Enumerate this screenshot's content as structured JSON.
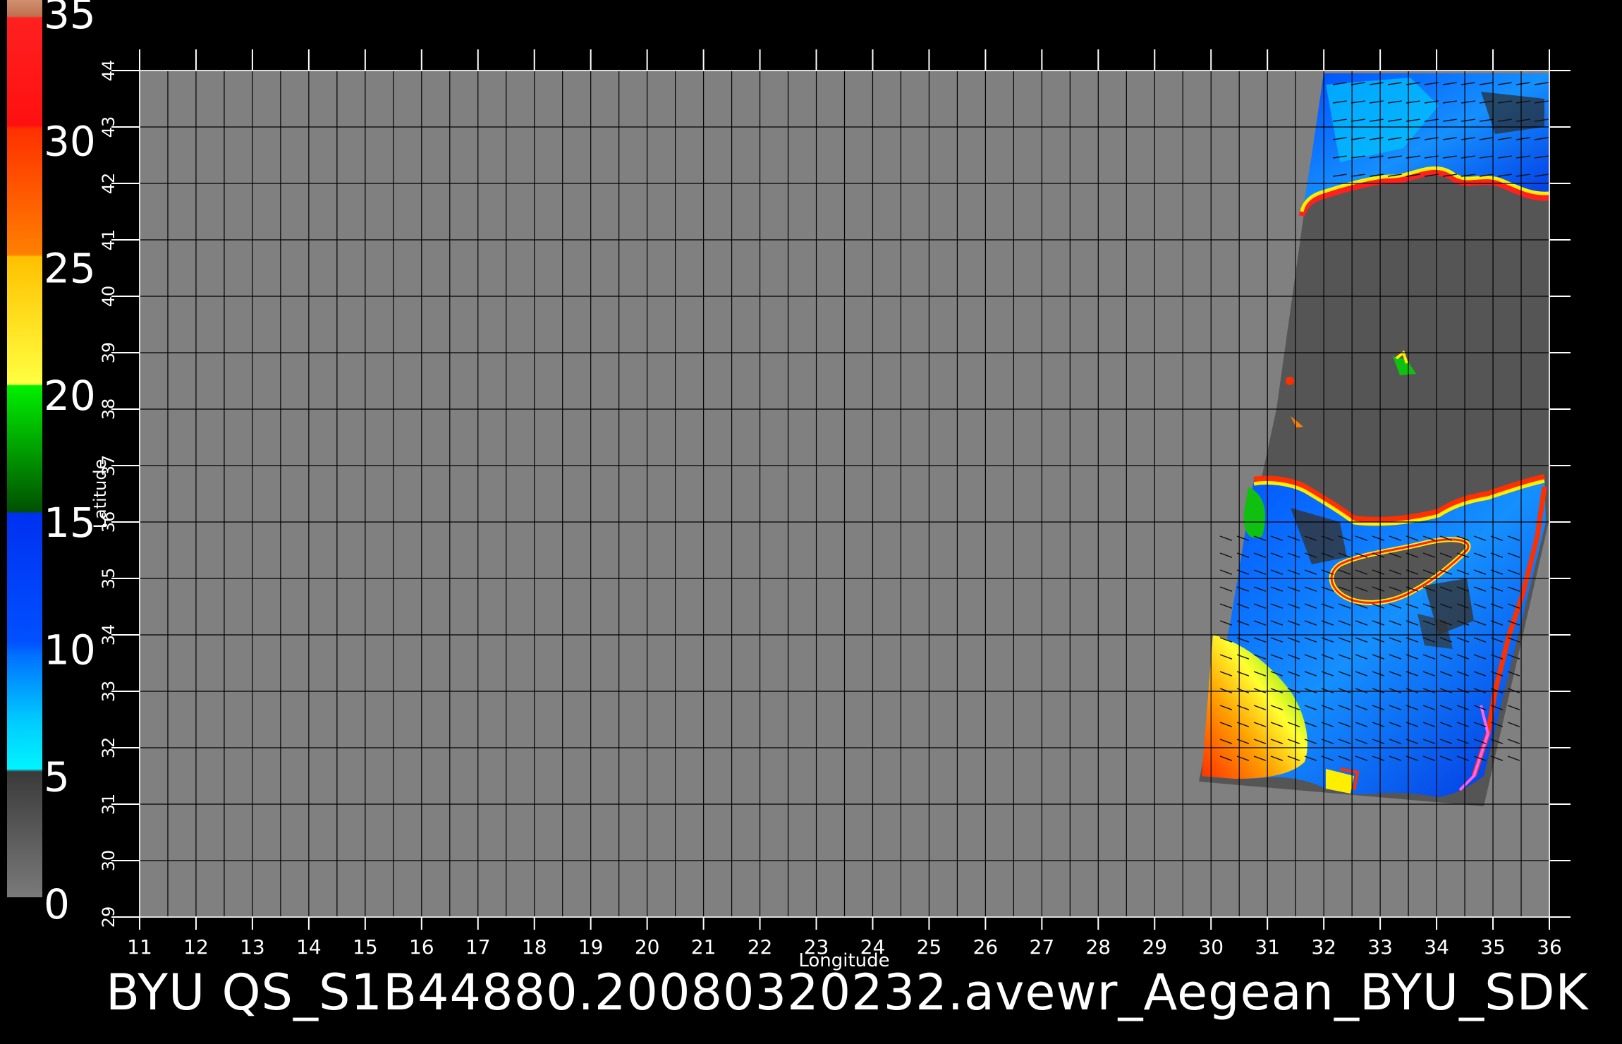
{
  "chart_data": {
    "type": "heatmap",
    "title": "BYU  QS_S1B44880.20080320232.avewr_Aegean_BYU_SDK",
    "xlabel": "Longitude",
    "ylabel": "Latitude",
    "xlim": [
      11,
      36
    ],
    "ylim": [
      29,
      44
    ],
    "x_ticks": [
      "11",
      "12",
      "13",
      "14",
      "15",
      "16",
      "17",
      "18",
      "19",
      "20",
      "21",
      "22",
      "23",
      "24",
      "25",
      "26",
      "27",
      "28",
      "29",
      "30",
      "31",
      "32",
      "33",
      "34",
      "35",
      "36"
    ],
    "y_ticks": [
      "29",
      "30",
      "31",
      "32",
      "33",
      "34",
      "35",
      "36",
      "37",
      "38",
      "39",
      "40",
      "41",
      "42",
      "43",
      "44"
    ],
    "grid": true,
    "colorbar": {
      "ticks": [
        "0",
        "5",
        "10",
        "15",
        "20",
        "25",
        "30",
        "35"
      ],
      "range": [
        0,
        35
      ],
      "colors": {
        "grey_low": "#4a4a4a",
        "grey_high": "#7a7a7a",
        "cyan": "#00f0ff",
        "light_blue": "#0080ff",
        "blue": "#0030ff",
        "green_dark": "#006000",
        "green": "#00e000",
        "yellow": "#ffff40",
        "gold": "#ffd000",
        "orange": "#ff7000",
        "red_orange": "#ff3000",
        "red": "#ff1010",
        "tan": "#c07050"
      }
    },
    "colors": {
      "background": "#000000",
      "plot_land": "#808080",
      "swath_dark": "#555555",
      "grid": "#000000"
    }
  }
}
